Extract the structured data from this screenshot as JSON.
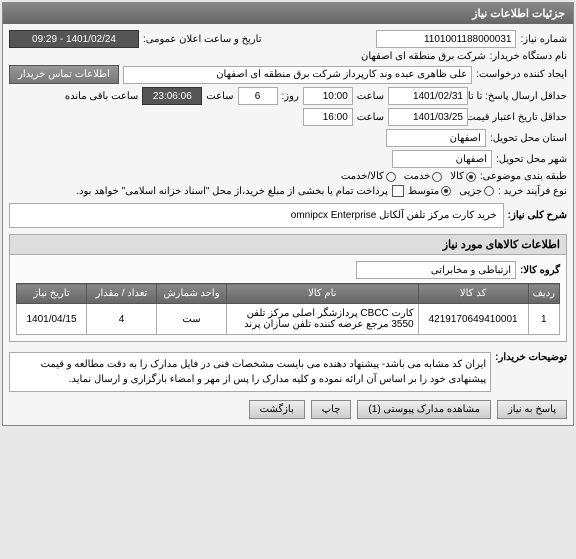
{
  "panel_title": "جزئیات اطلاعات نیاز",
  "need_number_label": "شماره نیاز:",
  "need_number": "1101001188000031",
  "announce_label": "تاریخ و ساعت اعلان عمومی:",
  "announce_value": "1401/02/24 - 09:29",
  "buyer_name_label": "نام دستگاه خریدار:",
  "buyer_name": "شرکت برق منطقه ای اصفهان",
  "requester_label": "ایجاد کننده درخواست:",
  "requester_value": "علی ظاهری عبده وند کارپرداز شرکت برق منطقه ای اصفهان",
  "contact_btn": "اطلاعات تماس خریدار",
  "deadline_label": "حداقل ارسال پاسخ: تا تاریخ:",
  "deadline_date": "1401/02/31",
  "deadline_time_label": "ساعت",
  "deadline_time": "10:00",
  "day_label": "روز:",
  "day_value": "6",
  "hour_label": "ساعت",
  "remaining_time": "23:06:06",
  "remaining_label": "ساعت باقی مانده",
  "validity_label": "حداقل تاریخ اعتبار قیمت: تا تاریخ:",
  "validity_date": "1401/03/25",
  "validity_time_label": "ساعت",
  "validity_time": "16:00",
  "province_label": "استان محل تحویل:",
  "province_value": "اصفهان",
  "city_label": "شهر محل تحویل:",
  "city_value": "اصفهان",
  "category_label": "طبقه بندی موضوعی:",
  "cat_goods": "کالا",
  "cat_service": "خدمت",
  "cat_both": "کالا/خدمت",
  "process_label": "نوع فرآیند خرید :",
  "proc_small": "جزیی",
  "proc_medium": "متوسط",
  "proc_note": "پرداخت تمام یا بخشی از مبلغ خرید،از محل \"اسناد خزانه اسلامی\" خواهد بود.",
  "desc_label": "شرح کلی نیاز:",
  "desc_value": "خرید کارت مرکز تلفن آلکاتل omnipcx Enterprise",
  "items_panel_title": "اطلاعات کالاهای مورد نیاز",
  "group_label": "گروه کالا:",
  "group_value": "ارتباطی و مخابراتی",
  "table": {
    "headers": [
      "ردیف",
      "کد کالا",
      "نام کالا",
      "واحد شمارش",
      "تعداد / مقدار",
      "تاریخ نیاز"
    ],
    "row": {
      "idx": "1",
      "code": "4219170649410001",
      "name": "کارت CBCC پردازشگر اصلی مرکز تلفن 3550 مرجع عرضه کننده تلفن سازان پرند",
      "unit": "ست",
      "qty": "4",
      "date": "1401/04/15"
    }
  },
  "buyer_notes_label": "توضیحات خریدار:",
  "buyer_notes": "ایران کد مشابه می باشد- پیشنهاد دهنده می بایست مشخصات فنی در فایل مدارک  را به دقت مطالعه و قیمت پیشنهادی خود را بر اساس آن ارائه نموده و کلیه مدارک را پس از مهر و امضاء بارگزاری و ارسال نماید.",
  "btn_reply": "پاسخ به نیاز",
  "btn_attachments": "مشاهده مدارک پیوستی (1)",
  "btn_print": "چاپ",
  "btn_back": "بازگشت"
}
